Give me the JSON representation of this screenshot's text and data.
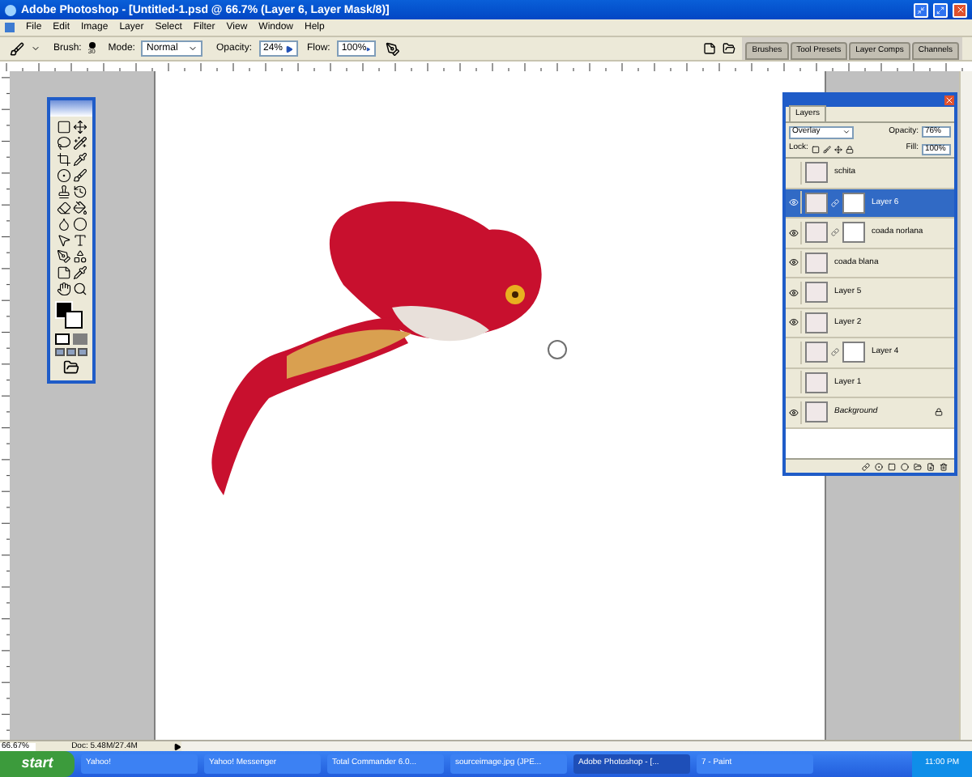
{
  "window": {
    "title": "Adobe Photoshop - [Untitled-1.psd @ 66.7% (Layer 6, Layer Mask/8)]"
  },
  "menu": [
    "File",
    "Edit",
    "Image",
    "Layer",
    "Select",
    "Filter",
    "View",
    "Window",
    "Help"
  ],
  "options_bar": {
    "brush_label": "Brush:",
    "brush_size": "30",
    "mode_label": "Mode:",
    "mode": "Normal",
    "opacity_label": "Opacity:",
    "opacity": "24%",
    "flow_label": "Flow:",
    "flow": "100%"
  },
  "palette_well": [
    {
      "label": "Brushes"
    },
    {
      "label": "Tool Presets"
    },
    {
      "label": "Layer Comps"
    },
    {
      "label": "Channels"
    }
  ],
  "layers_panel": {
    "tab": "Layers",
    "blend_mode": "Overlay",
    "opacity_label": "Opacity:",
    "opacity": "76%",
    "lock_label": "Lock:",
    "fill_label": "Fill:",
    "fill": "100%",
    "layers": [
      {
        "name": "schita",
        "visible": false,
        "selected": false,
        "mask": false,
        "kind": "layer"
      },
      {
        "name": "Layer 6",
        "visible": true,
        "selected": true,
        "mask": true,
        "kind": "layer"
      },
      {
        "name": "coada norlana",
        "visible": true,
        "selected": false,
        "mask": true,
        "kind": "layer"
      },
      {
        "name": "coada blana",
        "visible": true,
        "selected": false,
        "mask": false,
        "kind": "layer"
      },
      {
        "name": "Layer 5",
        "visible": true,
        "selected": false,
        "mask": false,
        "kind": "layer"
      },
      {
        "name": "Layer 2",
        "visible": true,
        "selected": false,
        "mask": false,
        "kind": "layer"
      },
      {
        "name": "Layer 4",
        "visible": false,
        "selected": false,
        "mask": true,
        "kind": "layer"
      },
      {
        "name": "Layer 1",
        "visible": false,
        "selected": false,
        "mask": false,
        "kind": "layer"
      },
      {
        "name": "Background",
        "visible": true,
        "selected": false,
        "mask": false,
        "kind": "background"
      }
    ]
  },
  "status_bar": {
    "zoom": "66.67%",
    "doc": "Doc: 5.48M/27.4M"
  },
  "taskbar": {
    "start": "start",
    "tasks": [
      {
        "label": "Yahoo!",
        "selected": false
      },
      {
        "label": "Yahoo! Messenger",
        "selected": false
      },
      {
        "label": "Total Commander 6.0...",
        "selected": false
      },
      {
        "label": "sourceimage.jpg (JPE...",
        "selected": false
      },
      {
        "label": "Adobe Photoshop - [...",
        "selected": true
      },
      {
        "label": "7 - Paint",
        "selected": false
      }
    ],
    "clock": "11:00 PM"
  }
}
